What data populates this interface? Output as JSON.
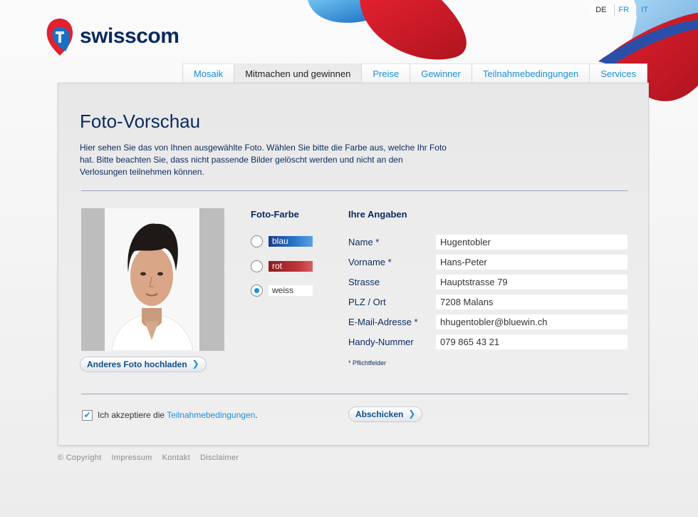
{
  "languages": [
    {
      "code": "DE",
      "active": true
    },
    {
      "code": "FR",
      "active": false
    },
    {
      "code": "IT",
      "active": false
    }
  ],
  "brand": {
    "name": "swisscom",
    "colors": {
      "navy": "#0b2a5e",
      "red": "#e2202f",
      "blue": "#1a8fd6"
    }
  },
  "tabs": [
    {
      "label": "Mosaik",
      "active": false
    },
    {
      "label": "Mitmachen und gewinnen",
      "active": true
    },
    {
      "label": "Preise",
      "active": false
    },
    {
      "label": "Gewinner",
      "active": false
    },
    {
      "label": "Teilnahmebedingungen",
      "active": false
    },
    {
      "label": "Services",
      "active": false
    }
  ],
  "page": {
    "title": "Foto-Vorschau",
    "intro": "Hier sehen Sie das von Ihnen ausgewählte Foto.  Wählen Sie bitte die Farbe aus, welche Ihr Foto hat. Bitte beachten Sie, dass nicht passende Bilder gelöscht werden und nicht an den Verlosungen teilnehmen können."
  },
  "photo": {
    "upload_button": "Anderes Foto hochladen"
  },
  "color_choice": {
    "title": "Foto-Farbe",
    "options": [
      {
        "label": "blau",
        "checked": false
      },
      {
        "label": "rot",
        "checked": false
      },
      {
        "label": "weiss",
        "checked": true
      }
    ]
  },
  "details": {
    "title": "Ihre Angaben",
    "fields": [
      {
        "label": "Name *",
        "value": "Hugentobler"
      },
      {
        "label": "Vorname *",
        "value": "Hans-Peter"
      },
      {
        "label": "Strasse",
        "value": "Hauptstrasse 79"
      },
      {
        "label": "PLZ / Ort",
        "value": "7208 Malans"
      },
      {
        "label": "E-Mail-Adresse *",
        "value": "hhugentobler@bluewin.ch"
      },
      {
        "label": "Handy-Nummer",
        "value": "079 865 43 21"
      }
    ],
    "footnote": "* Pflichtfelder"
  },
  "terms": {
    "prefix": "Ich akzeptiere die",
    "link": "Teilnahmebedingungen",
    "suffix": ".",
    "checked": true
  },
  "submit_button": "Abschicken",
  "footer": [
    "© Copyright",
    "Impressum",
    "Kontakt",
    "Disclaimer"
  ]
}
